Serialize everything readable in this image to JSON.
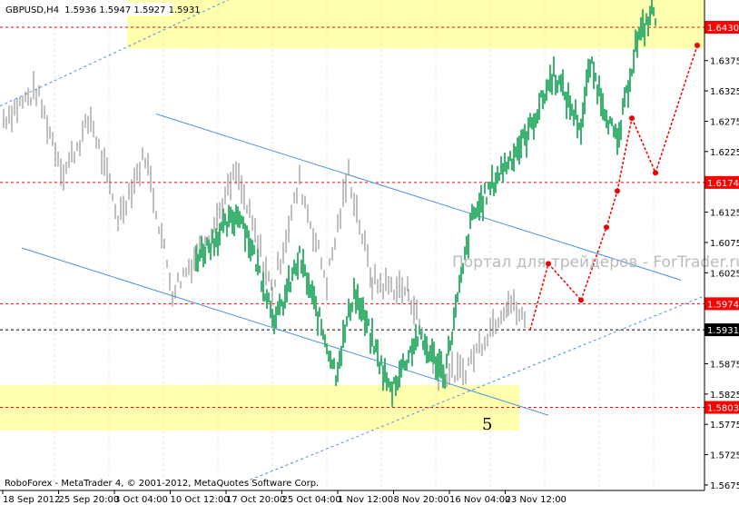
{
  "header": {
    "symbol": "GBPUSD,H4",
    "ohlc": "1.5936 1.5947 1.5927 1.5931"
  },
  "footer": {
    "copyright": "RoboForex - MetaTrader 4, © 2001-2012, MetaQuotes Software Corp."
  },
  "watermark": "Портал для трейдеров - ForTrader.ru",
  "wave_label": "5",
  "colors": {
    "bull": "#3cb371",
    "bear": "#808080",
    "level": "#ff0000",
    "zone": "#ffff99",
    "channel": "#4a90e2"
  },
  "chart_data": {
    "type": "line",
    "title": "GBPUSD,H4",
    "ylim": [
      1.565,
      1.648
    ],
    "x_ticks": [
      "18 Sep 2012",
      "25 Sep 20:00",
      "3 Oct 04:00",
      "10 Oct 12:00",
      "17 Oct 20:00",
      "25 Oct 04:00",
      "1 Nov 12:00",
      "8 Nov 20:00",
      "16 Nov 04:00",
      "23 Nov 12:00"
    ],
    "y_ticks": [
      "1.6375",
      "1.6325",
      "1.6275",
      "1.6225",
      "1.6125",
      "1.6075",
      "1.6025",
      "1.5875",
      "1.5825",
      "1.5775",
      "1.5725",
      "1.5675"
    ],
    "levels": [
      {
        "label": "1.6430",
        "value": 1.643,
        "color": "#ff0000"
      },
      {
        "label": "1.6174",
        "value": 1.6174,
        "color": "#ff0000"
      },
      {
        "label": "1.5974",
        "value": 1.5974,
        "color": "#ff0000"
      },
      {
        "label": "1.5803",
        "value": 1.5803,
        "color": "#ff0000"
      },
      {
        "label": "1.5931",
        "value": 1.5931,
        "color": "#000000"
      }
    ],
    "series": [
      {
        "name": "GBPUSD grey",
        "x": [
          2,
          20,
          35,
          50,
          65,
          80,
          95,
          115,
          130,
          150,
          165,
          180,
          192,
          205,
          225,
          240,
          255,
          270,
          280,
          290
        ],
        "y": [
          1.628,
          1.6325,
          1.619,
          1.628,
          1.6115,
          1.622,
          1.5995,
          1.6085,
          1.619,
          1.5995,
          1.6175,
          1.601,
          1.619,
          1.601,
          1.5995,
          1.586,
          1.586,
          1.5935,
          1.598,
          1.594
        ]
      },
      {
        "name": "GBPUSD green",
        "x": [
          108,
          132,
          152,
          165,
          185,
          195,
          215,
          230,
          245,
          260,
          275,
          290,
          305,
          320,
          325,
          340,
          350,
          360,
          362
        ],
        "y": [
          1.605,
          1.6125,
          1.5945,
          1.605,
          1.586,
          1.5995,
          1.583,
          1.592,
          1.586,
          1.6115,
          1.619,
          1.625,
          1.6355,
          1.6265,
          1.637,
          1.6235,
          1.64,
          1.646,
          1.6422
        ]
      }
    ],
    "forecast": {
      "x": [
        292,
        302,
        320,
        334,
        340,
        348,
        361,
        384
      ],
      "y": [
        1.5931,
        1.604,
        1.598,
        1.61,
        1.616,
        1.628,
        1.619,
        1.64
      ]
    },
    "zones": [
      {
        "x": [
          70,
          388
        ],
        "y": [
          1.6395,
          1.648
        ]
      },
      {
        "x": [
          0,
          286
        ],
        "y": [
          1.5765,
          1.584
        ]
      }
    ],
    "channels": [
      {
        "x": [
          86,
          375
        ],
        "y": [
          1.6287,
          1.6013
        ],
        "style": "solid"
      },
      {
        "x": [
          12,
          302
        ],
        "y": [
          1.6066,
          1.579
        ],
        "style": "solid"
      },
      {
        "x": [
          135,
          388
        ],
        "y": [
          1.568,
          1.5987
        ],
        "style": "dashed"
      },
      {
        "x": [
          0,
          140
        ],
        "y": [
          1.63,
          1.6495
        ],
        "style": "dashed"
      }
    ]
  }
}
